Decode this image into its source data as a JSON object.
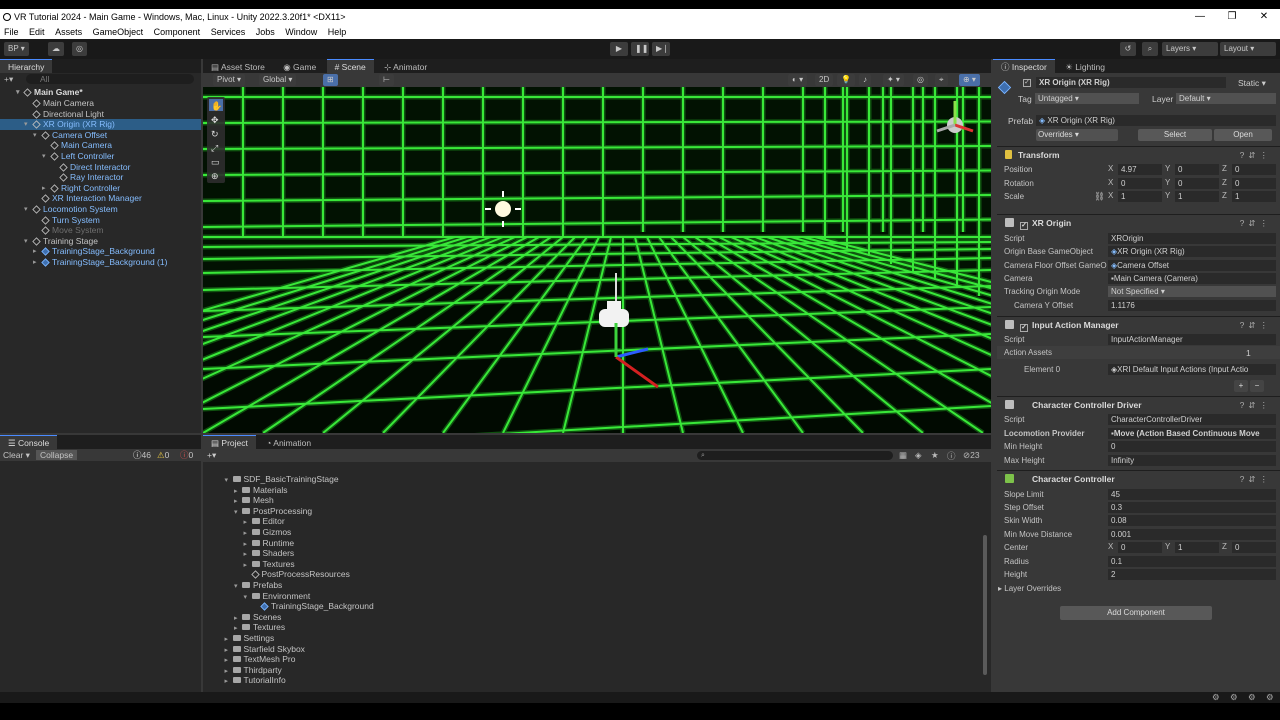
{
  "window": {
    "title": "VR Tutorial 2024 - Main Game - Windows, Mac, Linux - Unity 2022.3.20f1* <DX11>"
  },
  "menu": [
    "File",
    "Edit",
    "Assets",
    "GameObject",
    "Component",
    "Services",
    "Jobs",
    "Window",
    "Help"
  ],
  "toolbar": {
    "account": "BP",
    "layers": "Layers",
    "layout": "Layout"
  },
  "hierarchy": {
    "tab": "Hierarchy",
    "search_placeholder": "All",
    "scene": "Main Game*",
    "items": [
      {
        "label": "Main Camera",
        "depth": 1,
        "arrow": "",
        "prefab": false
      },
      {
        "label": "Directional Light",
        "depth": 1,
        "arrow": "",
        "prefab": false
      },
      {
        "label": "XR Origin (XR Rig)",
        "depth": 1,
        "arrow": "▾",
        "prefab": true,
        "selected": true
      },
      {
        "label": "Camera Offset",
        "depth": 2,
        "arrow": "▾",
        "prefab": true
      },
      {
        "label": "Main Camera",
        "depth": 3,
        "arrow": "",
        "prefab": true
      },
      {
        "label": "Left Controller",
        "depth": 3,
        "arrow": "▾",
        "prefab": true
      },
      {
        "label": "Direct Interactor",
        "depth": 4,
        "arrow": "",
        "prefab": true
      },
      {
        "label": "Ray Interactor",
        "depth": 4,
        "arrow": "",
        "prefab": true
      },
      {
        "label": "Right Controller",
        "depth": 3,
        "arrow": "▸",
        "prefab": true
      },
      {
        "label": "XR Interaction Manager",
        "depth": 2,
        "arrow": "",
        "prefab": true
      },
      {
        "label": "Locomotion System",
        "depth": 1,
        "arrow": "▾",
        "prefab": true
      },
      {
        "label": "Turn System",
        "depth": 2,
        "arrow": "",
        "prefab": true
      },
      {
        "label": "Move System",
        "depth": 2,
        "arrow": "",
        "prefab": false,
        "dim": true
      },
      {
        "label": "Training Stage",
        "depth": 1,
        "arrow": "▾",
        "prefab": false
      },
      {
        "label": "TrainingStage_Background",
        "depth": 2,
        "arrow": "▸",
        "prefab": true,
        "cube": true
      },
      {
        "label": "TrainingStage_Background (1)",
        "depth": 2,
        "arrow": "▸",
        "prefab": true,
        "cube": true
      }
    ]
  },
  "scene_tabs": [
    "Asset Store",
    "Game",
    "Scene",
    "Animator"
  ],
  "scene_toolbar": {
    "pivot": "Pivot",
    "global": "Global",
    "mode2d": "2D"
  },
  "console": {
    "tab": "Console",
    "clear": "Clear",
    "collapse": "Collapse",
    "info_count": "46",
    "warn_count": "0",
    "error_count": "0"
  },
  "project": {
    "tabs": [
      "Project",
      "Animation"
    ],
    "hidden_count": "23",
    "items": [
      {
        "label": "SDF_BasicTrainingStage",
        "depth": 1,
        "arrow": "▾"
      },
      {
        "label": "Materials",
        "depth": 2,
        "arrow": "▸"
      },
      {
        "label": "Mesh",
        "depth": 2,
        "arrow": "▸"
      },
      {
        "label": "PostProcessing",
        "depth": 2,
        "arrow": "▾"
      },
      {
        "label": "Editor",
        "depth": 3,
        "arrow": "▸"
      },
      {
        "label": "Gizmos",
        "depth": 3,
        "arrow": "▸"
      },
      {
        "label": "Runtime",
        "depth": 3,
        "arrow": "▸"
      },
      {
        "label": "Shaders",
        "depth": 3,
        "arrow": "▸"
      },
      {
        "label": "Textures",
        "depth": 3,
        "arrow": "▸"
      },
      {
        "label": "PostProcessResources",
        "depth": 3,
        "arrow": "",
        "file": true
      },
      {
        "label": "Prefabs",
        "depth": 2,
        "arrow": "▾"
      },
      {
        "label": "Environment",
        "depth": 3,
        "arrow": "▾"
      },
      {
        "label": "TrainingStage_Background",
        "depth": 4,
        "arrow": "",
        "prefab": true
      },
      {
        "label": "Scenes",
        "depth": 2,
        "arrow": "▸"
      },
      {
        "label": "Textures",
        "depth": 2,
        "arrow": "▸"
      },
      {
        "label": "Settings",
        "depth": 1,
        "arrow": "▸"
      },
      {
        "label": "Starfield Skybox",
        "depth": 1,
        "arrow": "▸"
      },
      {
        "label": "TextMesh Pro",
        "depth": 1,
        "arrow": "▸"
      },
      {
        "label": "Thirdparty",
        "depth": 1,
        "arrow": "▸"
      },
      {
        "label": "TutorialInfo",
        "depth": 1,
        "arrow": "▸"
      }
    ]
  },
  "inspector": {
    "tabs": [
      "Inspector",
      "Lighting"
    ],
    "object_name": "XR Origin (XR Rig)",
    "static_label": "Static",
    "tag_label": "Tag",
    "tag_value": "Untagged",
    "layer_label": "Layer",
    "layer_value": "Default",
    "prefab_label": "Prefab",
    "prefab_value": "XR Origin (XR Rig)",
    "overrides": "Overrides",
    "select": "Select",
    "open": "Open",
    "transform": {
      "title": "Transform",
      "position_label": "Position",
      "position": {
        "x": "4.97",
        "y": "0",
        "z": "0"
      },
      "rotation_label": "Rotation",
      "rotation": {
        "x": "0",
        "y": "0",
        "z": "0"
      },
      "scale_label": "Scale",
      "scale": {
        "x": "1",
        "y": "1",
        "z": "1"
      }
    },
    "xr_origin": {
      "title": "XR Origin",
      "script_label": "Script",
      "script_value": "XROrigin",
      "origin_base_label": "Origin Base GameObject",
      "origin_base_value": "XR Origin (XR Rig)",
      "camera_floor_label": "Camera Floor Offset GameO",
      "camera_floor_value": "Camera Offset",
      "camera_label": "Camera",
      "camera_value": "Main Camera (Camera)",
      "tracking_label": "Tracking Origin Mode",
      "tracking_value": "Not Specified",
      "camera_y_label": "Camera Y Offset",
      "camera_y_value": "1.1176"
    },
    "input_action_manager": {
      "title": "Input Action Manager",
      "script_label": "Script",
      "script_value": "InputActionManager",
      "assets_label": "Action Assets",
      "assets_count": "1",
      "element_label": "Element 0",
      "element_value": "XRI Default Input Actions (Input Actio"
    },
    "ccd": {
      "title": "Character Controller Driver",
      "script_label": "Script",
      "script_value": "CharacterControllerDriver",
      "locomotion_label": "Locomotion Provider",
      "locomotion_value": "Move (Action Based Continuous Move",
      "min_height_label": "Min Height",
      "min_height_value": "0",
      "max_height_label": "Max Height",
      "max_height_value": "Infinity"
    },
    "cc": {
      "title": "Character Controller",
      "slope_label": "Slope Limit",
      "slope_value": "45",
      "step_label": "Step Offset",
      "step_value": "0.3",
      "skin_label": "Skin Width",
      "skin_value": "0.08",
      "minmove_label": "Min Move Distance",
      "minmove_value": "0.001",
      "center_label": "Center",
      "center": {
        "x": "0",
        "y": "1",
        "z": "0"
      },
      "radius_label": "Radius",
      "radius_value": "0.1",
      "height_label": "Height",
      "height_value": "2",
      "layer_overrides": "Layer Overrides"
    },
    "add_component": "Add Component"
  },
  "colors": {
    "grid": "#3dff3d",
    "selection": "#2c5d87",
    "prefab_text": "#85bdff"
  }
}
